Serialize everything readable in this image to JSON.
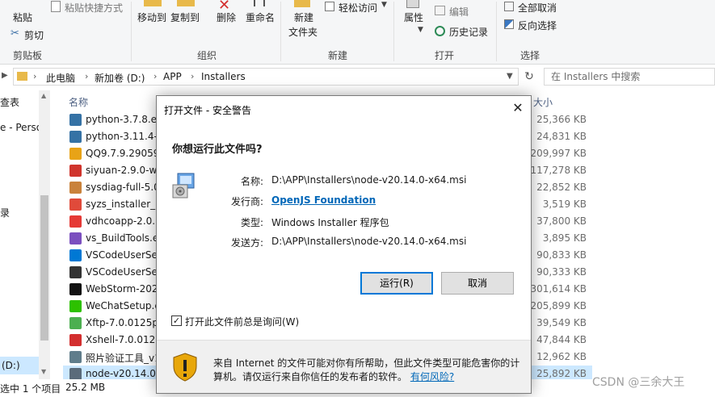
{
  "ribbon": {
    "clipboard": {
      "paste": "粘贴",
      "paste_shortcut": "粘贴快捷方式",
      "cut": "剪切",
      "group": "剪贴板"
    },
    "organize": {
      "move_to": "移动到",
      "copy_to": "复制到",
      "delete": "删除",
      "rename": "重命名",
      "group": "组织"
    },
    "new": {
      "new_folder_line1": "新建",
      "new_folder_line2": "文件夹",
      "easy_access": "轻松访问",
      "group": "新建"
    },
    "open": {
      "properties": "属性",
      "edit": "编辑",
      "history": "历史记录",
      "group": "打开"
    },
    "select": {
      "select_all": "全部取消",
      "invert": "反向选择",
      "group": "选择"
    }
  },
  "address": {
    "crumbs": [
      "此电脑",
      "新加卷 (D:)",
      "APP",
      "Installers"
    ],
    "search_placeholder": "在 Installers 中搜索"
  },
  "navpane": {
    "items": [
      "查表",
      "e - Perso",
      "录",
      "(D:)"
    ]
  },
  "filelist": {
    "header_name": "名称",
    "header_size": "大小",
    "files": [
      {
        "name": "python-3.7.8.ex",
        "size": "25,366 KB",
        "color": "#3572a5"
      },
      {
        "name": "python-3.11.4-a",
        "size": "24,831 KB",
        "color": "#3572a5"
      },
      {
        "name": "QQ9.7.9.29059.",
        "size": "209,997 KB",
        "color": "#e8a317"
      },
      {
        "name": "siyuan-2.9.0-wi",
        "size": "117,278 KB",
        "color": "#d0342c"
      },
      {
        "name": "sysdiag-full-5.0",
        "size": "22,852 KB",
        "color": "#c9823b"
      },
      {
        "name": "syzs_installer_1",
        "size": "3,519 KB",
        "color": "#e04a3a"
      },
      {
        "name": "vdhcoapp-2.0.1",
        "size": "37,800 KB",
        "color": "#e53935"
      },
      {
        "name": "vs_BuildTools.e",
        "size": "3,895 KB",
        "color": "#7b4fbf"
      },
      {
        "name": "VSCodeUserSe",
        "size": "90,833 KB",
        "color": "#0078d4"
      },
      {
        "name": "VSCodeUserSe",
        "size": "90,333 KB",
        "color": "#333333"
      },
      {
        "name": "WebStorm-202",
        "size": "301,614 KB",
        "color": "#111111"
      },
      {
        "name": "WeChatSetup.e",
        "size": "205,899 KB",
        "color": "#2dc100"
      },
      {
        "name": "Xftp-7.0.0125p.",
        "size": "39,549 KB",
        "color": "#4caf50"
      },
      {
        "name": "Xshell-7.0.0128",
        "size": "47,844 KB",
        "color": "#d32f2f"
      },
      {
        "name": "照片验证工具_v1",
        "size": "12,962 KB",
        "color": "#607d8b"
      },
      {
        "name": "node-v20.14.0-",
        "size": "25,892 KB",
        "color": "#5b6b7a"
      }
    ]
  },
  "status": {
    "selected": "选中 1 个项目",
    "size": "25.2 MB"
  },
  "dialog": {
    "title": "打开文件 - 安全警告",
    "close": "✕",
    "question": "你想运行此文件吗?",
    "name_label": "名称:",
    "name_value": "D:\\APP\\Installers\\node-v20.14.0-x64.msi",
    "publisher_label": "发行商:",
    "publisher_value": "OpenJS Foundation",
    "type_label": "类型:",
    "type_value": "Windows Installer 程序包",
    "from_label": "发送方:",
    "from_value": "D:\\APP\\Installers\\node-v20.14.0-x64.msi",
    "run_button": "运行(R)",
    "cancel_button": "取消",
    "checkbox_label": "打开此文件前总是询问(W)",
    "checkbox_mark": "✓",
    "warning_text": "来自 Internet 的文件可能对你有所帮助，但此文件类型可能危害你的计算机。请仅运行来自你信任的发布者的软件。",
    "warning_link": "有何风险?"
  },
  "watermark": "CSDN @三余大王"
}
